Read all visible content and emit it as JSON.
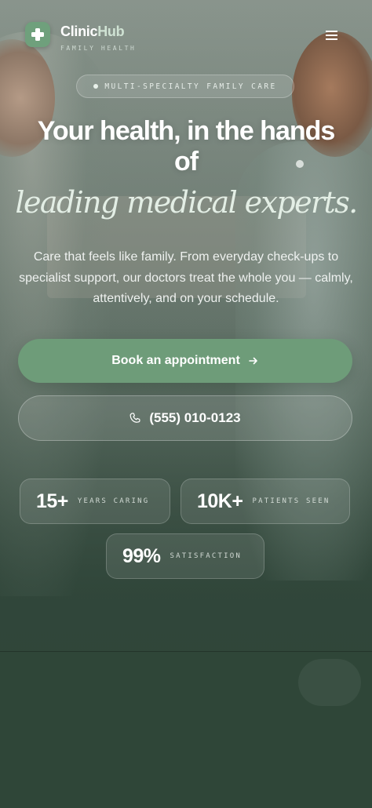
{
  "brand": {
    "name_part1": "Clinic",
    "name_part2": "Hub",
    "tagline": "FAMILY HEALTH",
    "logo_icon": "medical-cross-icon",
    "accent_color": "#6e9c79"
  },
  "header": {
    "menu_icon": "hamburger-menu-icon"
  },
  "hero": {
    "badge": "MULTI-SPECIALTY FAMILY CARE",
    "headline_line1": "Your health, in the hands",
    "headline_line2": "of",
    "headline_serif": "leading medical experts.",
    "lead": "Care that feels like family. From everyday check-ups to specialist support, our doctors treat the whole you — calmly, attentively, and on your schedule."
  },
  "actions": {
    "primary_label": "Book an appointment",
    "primary_icon": "arrow-right-icon",
    "secondary_label": "(555) 010-0123",
    "secondary_icon": "phone-icon"
  },
  "stats": [
    {
      "value": "15+",
      "label": "YEARS CARING"
    },
    {
      "value": "10K+",
      "label": "PATIENTS SEEN"
    },
    {
      "value": "99%",
      "label": "SATISFACTION"
    }
  ]
}
